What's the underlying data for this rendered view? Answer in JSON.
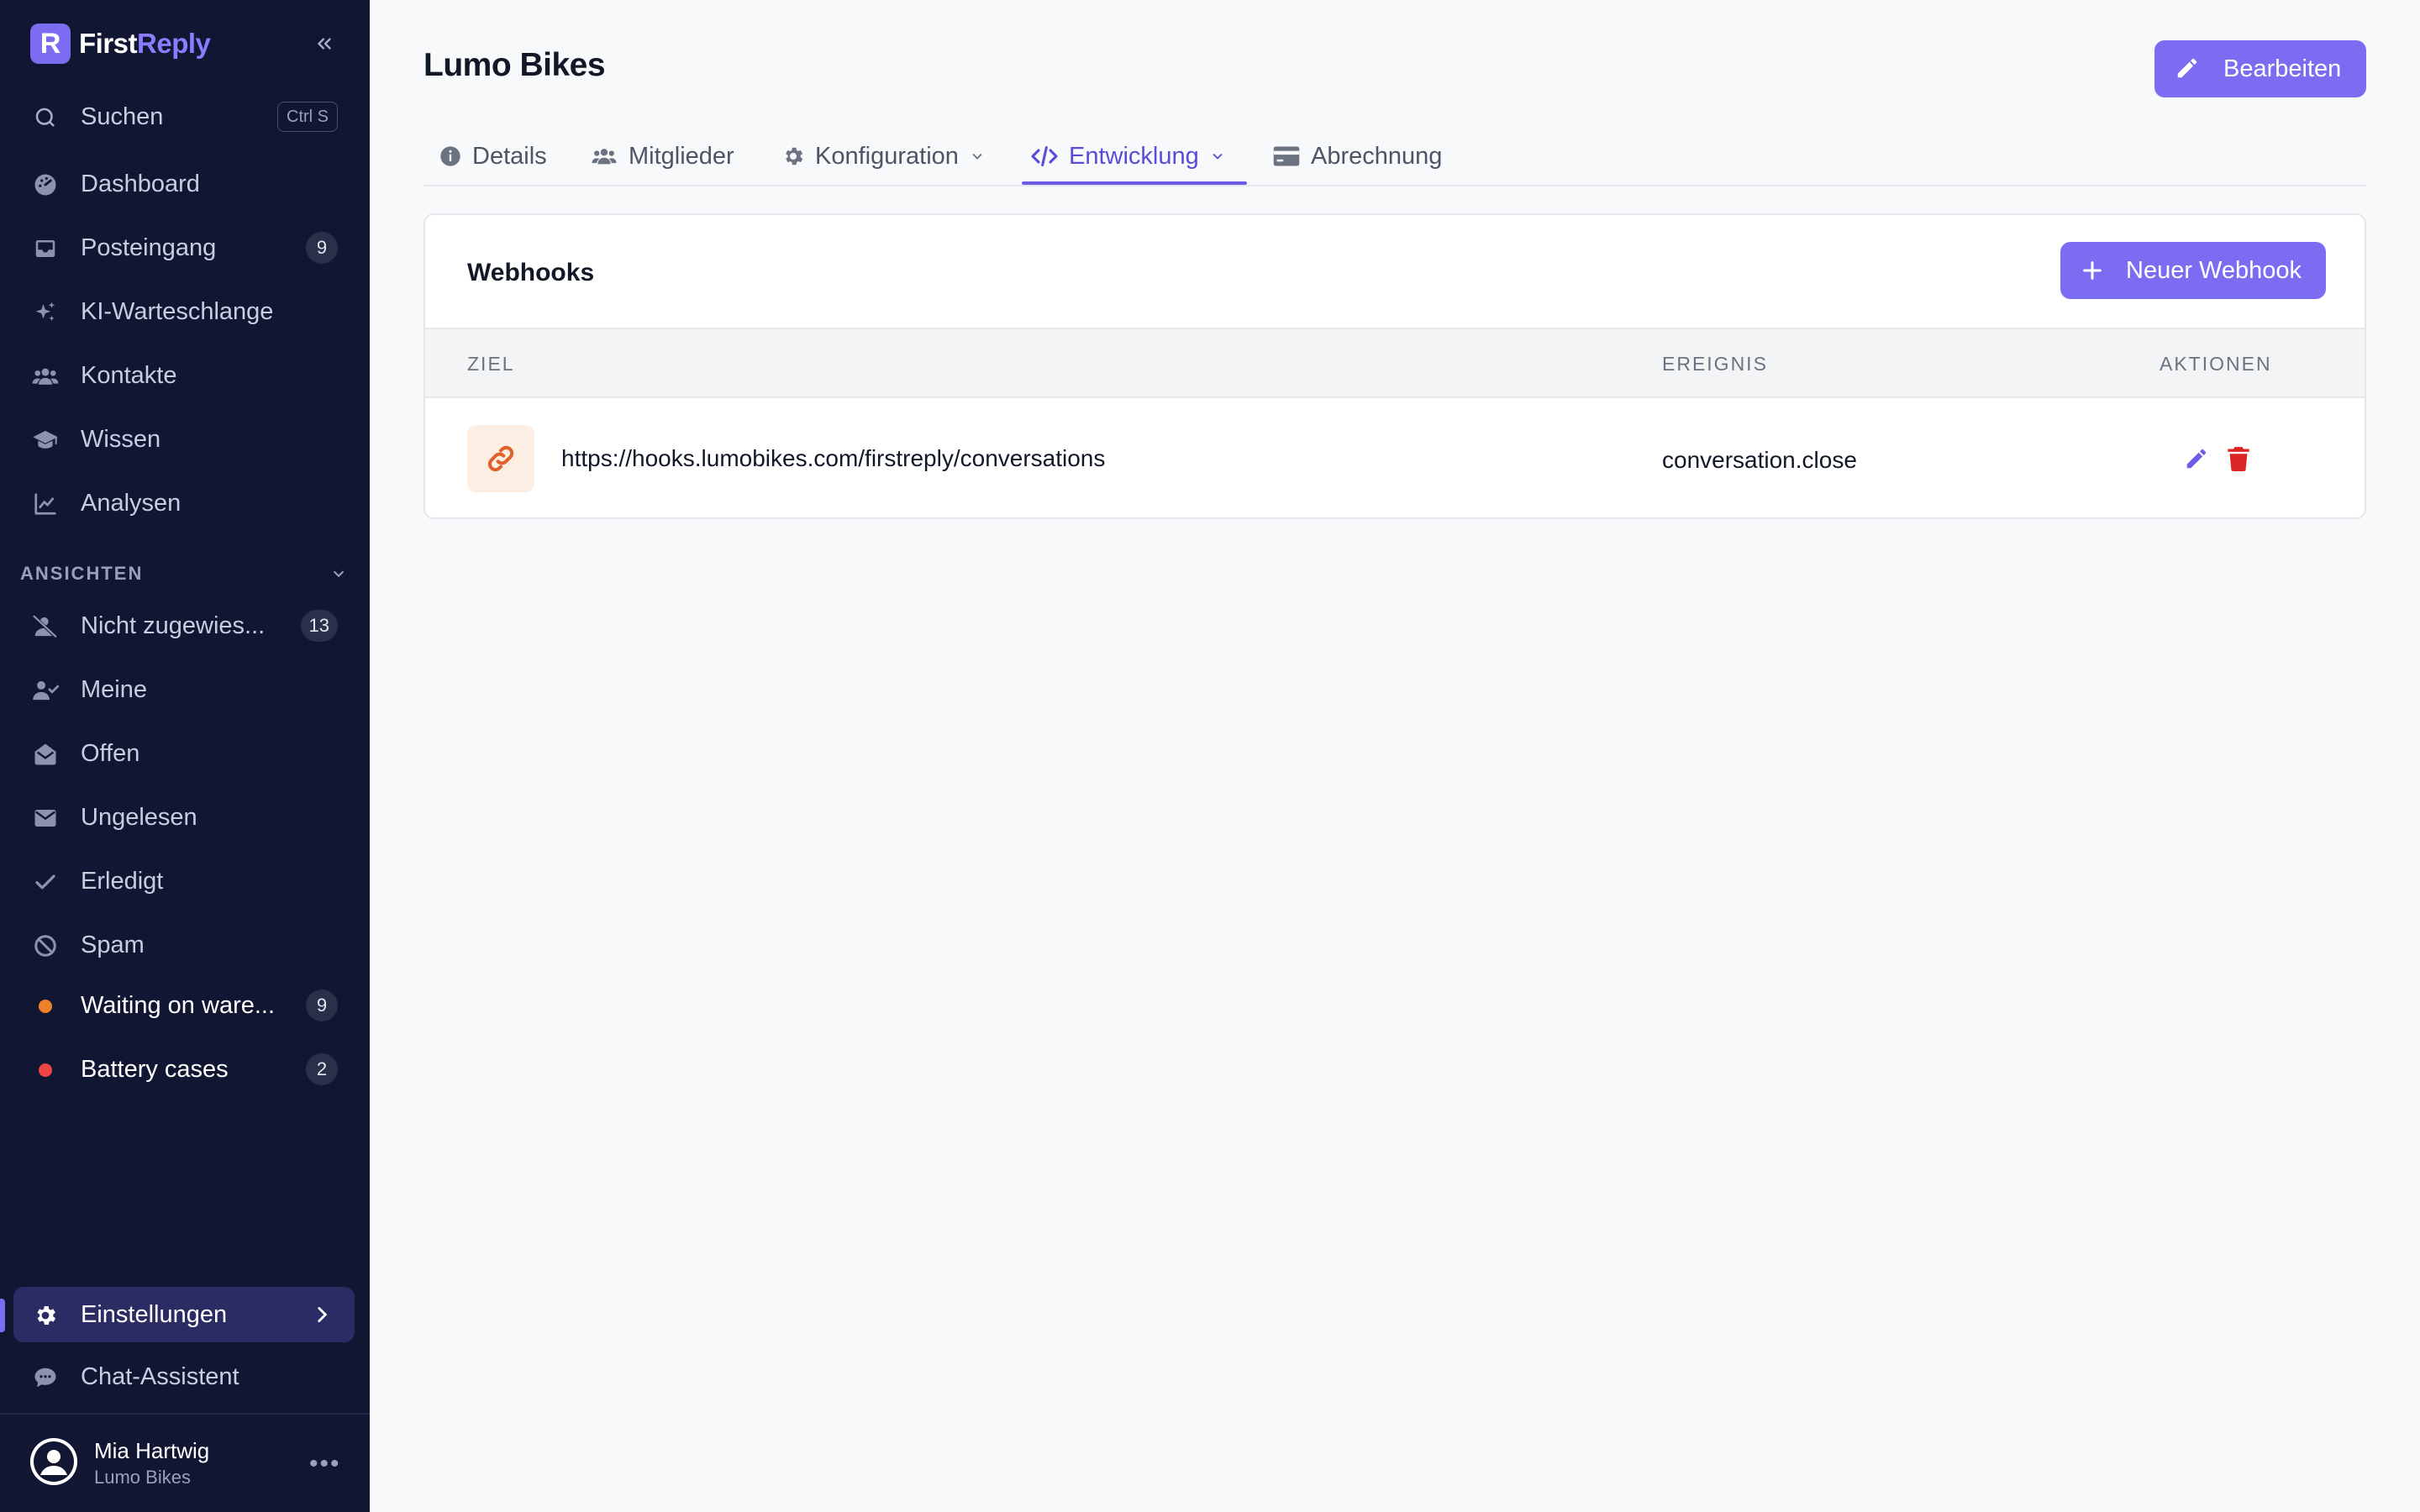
{
  "brand": {
    "name_first": "First",
    "name_second": "Reply",
    "logo_letter": "R"
  },
  "sidebar": {
    "search": {
      "label": "Suchen",
      "shortcut": "Ctrl S"
    },
    "items": [
      {
        "label": "Dashboard",
        "icon": "dashboard-icon"
      },
      {
        "label": "Posteingang",
        "icon": "inbox-icon",
        "badge": "9"
      },
      {
        "label": "KI-Warteschlange",
        "icon": "sparkles-icon"
      },
      {
        "label": "Kontakte",
        "icon": "users-icon"
      },
      {
        "label": "Wissen",
        "icon": "graduation-cap-icon"
      },
      {
        "label": "Analysen",
        "icon": "chart-line-icon"
      }
    ],
    "views_label": "ANSICHTEN",
    "views": [
      {
        "label": "Nicht zugewies...",
        "icon": "user-slash-icon",
        "badge": "13"
      },
      {
        "label": "Meine",
        "icon": "user-check-icon"
      },
      {
        "label": "Offen",
        "icon": "envelope-open-icon"
      },
      {
        "label": "Ungelesen",
        "icon": "envelope-icon"
      },
      {
        "label": "Erledigt",
        "icon": "check-icon"
      },
      {
        "label": "Spam",
        "icon": "ban-icon"
      },
      {
        "label": "Waiting on ware...",
        "icon": "dot-icon",
        "badge": "9",
        "color": "#f0832a"
      },
      {
        "label": "Battery cases",
        "icon": "dot-icon",
        "badge": "2",
        "color": "#ef4444"
      }
    ],
    "settings": {
      "label": "Einstellungen"
    },
    "assistant": {
      "label": "Chat-Assistent"
    },
    "user": {
      "name": "Mia Hartwig",
      "org": "Lumo Bikes"
    }
  },
  "page": {
    "title": "Lumo Bikes",
    "edit_label": "Bearbeiten",
    "tabs": [
      {
        "label": "Details",
        "icon": "info-icon"
      },
      {
        "label": "Mitglieder",
        "icon": "users-icon"
      },
      {
        "label": "Konfiguration",
        "icon": "gear-icon",
        "dropdown": true
      },
      {
        "label": "Entwicklung",
        "icon": "code-icon",
        "dropdown": true,
        "active": true
      },
      {
        "label": "Abrechnung",
        "icon": "credit-card-icon"
      }
    ]
  },
  "webhooks": {
    "title": "Webhooks",
    "new_label": "Neuer Webhook",
    "columns": {
      "target": "ZIEL",
      "event": "EREIGNIS",
      "actions": "AKTIONEN"
    },
    "rows": [
      {
        "url": "https://hooks.lumobikes.com/firstreply/conversations",
        "event": "conversation.close"
      }
    ]
  },
  "colors": {
    "sidebar_bg": "#111633",
    "accent": "#7c6cf2",
    "danger": "#dc2626"
  }
}
